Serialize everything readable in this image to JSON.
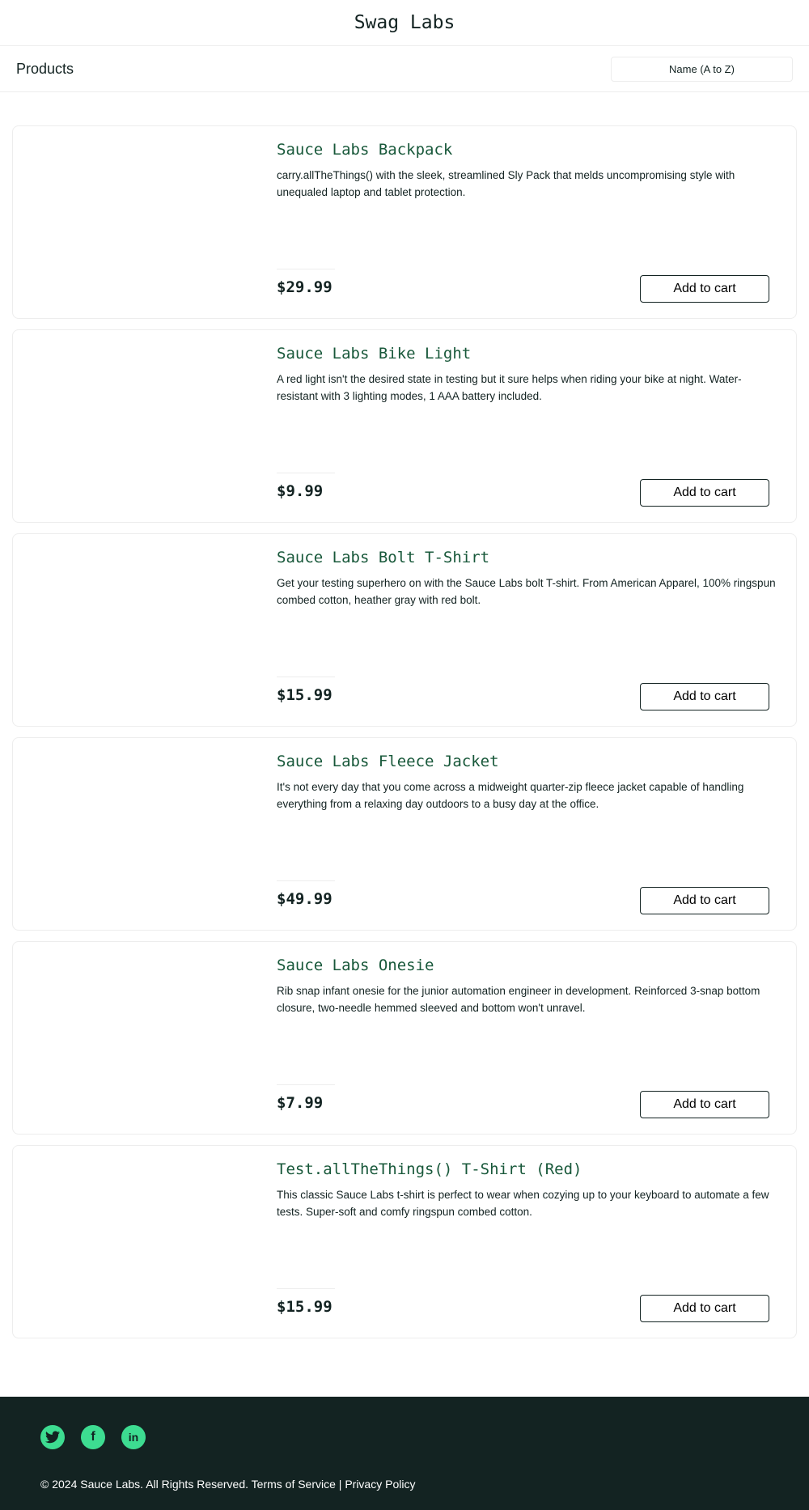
{
  "header": {
    "title": "Swag Labs"
  },
  "subheader": {
    "title": "Products",
    "sort_value": "Name (A to Z)"
  },
  "products": [
    {
      "name": "Sauce Labs Backpack",
      "desc": "carry.allTheThings() with the sleek, streamlined Sly Pack that melds uncompromising style with unequaled laptop and tablet protection.",
      "price": "$29.99",
      "button": "Add to cart"
    },
    {
      "name": "Sauce Labs Bike Light",
      "desc": "A red light isn't the desired state in testing but it sure helps when riding your bike at night. Water-resistant with 3 lighting modes, 1 AAA battery included.",
      "price": "$9.99",
      "button": "Add to cart"
    },
    {
      "name": "Sauce Labs Bolt T-Shirt",
      "desc": "Get your testing superhero on with the Sauce Labs bolt T-shirt. From American Apparel, 100% ringspun combed cotton, heather gray with red bolt.",
      "price": "$15.99",
      "button": "Add to cart"
    },
    {
      "name": "Sauce Labs Fleece Jacket",
      "desc": "It's not every day that you come across a midweight quarter-zip fleece jacket capable of handling everything from a relaxing day outdoors to a busy day at the office.",
      "price": "$49.99",
      "button": "Add to cart"
    },
    {
      "name": "Sauce Labs Onesie",
      "desc": "Rib snap infant onesie for the junior automation engineer in development. Reinforced 3-snap bottom closure, two-needle hemmed sleeved and bottom won't unravel.",
      "price": "$7.99",
      "button": "Add to cart"
    },
    {
      "name": "Test.allTheThings() T-Shirt (Red)",
      "desc": "This classic Sauce Labs t-shirt is perfect to wear when cozying up to your keyboard to automate a few tests. Super-soft and comfy ringspun combed cotton.",
      "price": "$15.99",
      "button": "Add to cart"
    }
  ],
  "footer": {
    "icons": [
      "twitter-icon",
      "facebook-icon",
      "linkedin-icon"
    ],
    "copyright": "© 2024 Sauce Labs. All Rights Reserved. Terms of Service | Privacy Policy"
  },
  "colors": {
    "accent": "#3ddc91",
    "footer_bg": "#132322",
    "product_name": "#18583a"
  }
}
